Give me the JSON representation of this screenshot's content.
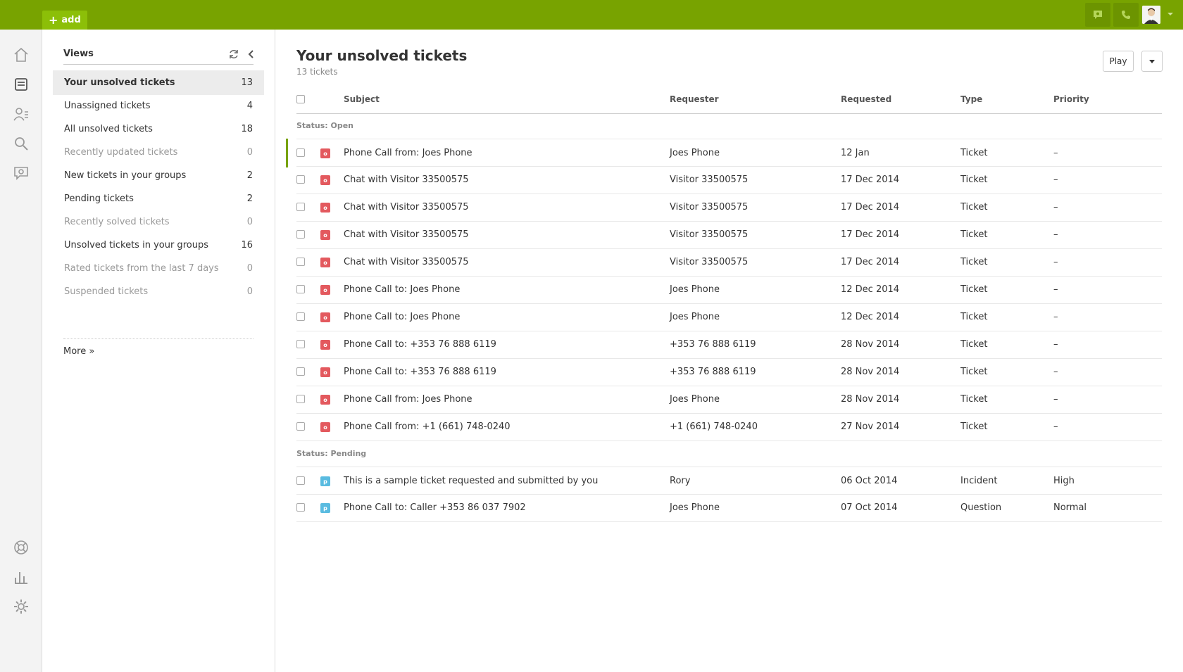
{
  "topbar": {
    "add_label": "add",
    "add_icon": "plus-icon",
    "accent": "#78a300",
    "icons": [
      "chat-icon",
      "phone-icon",
      "avatar"
    ]
  },
  "leftnav": {
    "items": [
      "home-icon",
      "views-icon",
      "customers-icon",
      "search-icon",
      "chat-icon",
      "help-icon",
      "reports-icon",
      "settings-icon"
    ]
  },
  "views": {
    "title": "Views",
    "items": [
      {
        "label": "Your unsolved tickets",
        "count": "13",
        "active": true,
        "dim": false
      },
      {
        "label": "Unassigned tickets",
        "count": "4",
        "active": false,
        "dim": false
      },
      {
        "label": "All unsolved tickets",
        "count": "18",
        "active": false,
        "dim": false
      },
      {
        "label": "Recently updated tickets",
        "count": "0",
        "active": false,
        "dim": true
      },
      {
        "label": "New tickets in your groups",
        "count": "2",
        "active": false,
        "dim": false
      },
      {
        "label": "Pending tickets",
        "count": "2",
        "active": false,
        "dim": false
      },
      {
        "label": "Recently solved tickets",
        "count": "0",
        "active": false,
        "dim": true
      },
      {
        "label": "Unsolved tickets in your groups",
        "count": "16",
        "active": false,
        "dim": false
      },
      {
        "label": "Rated tickets from the last 7 days",
        "count": "0",
        "active": false,
        "dim": true
      },
      {
        "label": "Suspended tickets",
        "count": "0",
        "active": false,
        "dim": true
      }
    ],
    "more_label": "More »"
  },
  "main": {
    "title": "Your unsolved tickets",
    "subtitle": "13 tickets",
    "play_label": "Play",
    "columns": {
      "subject": "Subject",
      "requester": "Requester",
      "requested": "Requested",
      "type": "Type",
      "priority": "Priority"
    },
    "groups": [
      {
        "label": "Status: Open",
        "status_letter": "o",
        "status_color": "#e3595e",
        "rows": [
          {
            "subject": "Phone Call from: Joes Phone",
            "requester": "Joes Phone",
            "requested": "12 Jan",
            "type": "Ticket",
            "priority": "–"
          },
          {
            "subject": "Chat with Visitor 33500575",
            "requester": "Visitor 33500575",
            "requested": "17 Dec 2014",
            "type": "Ticket",
            "priority": "–"
          },
          {
            "subject": "Chat with Visitor 33500575",
            "requester": "Visitor 33500575",
            "requested": "17 Dec 2014",
            "type": "Ticket",
            "priority": "–"
          },
          {
            "subject": "Chat with Visitor 33500575",
            "requester": "Visitor 33500575",
            "requested": "17 Dec 2014",
            "type": "Ticket",
            "priority": "–"
          },
          {
            "subject": "Chat with Visitor 33500575",
            "requester": "Visitor 33500575",
            "requested": "17 Dec 2014",
            "type": "Ticket",
            "priority": "–"
          },
          {
            "subject": "Phone Call to: Joes Phone",
            "requester": "Joes Phone",
            "requested": "12 Dec 2014",
            "type": "Ticket",
            "priority": "–"
          },
          {
            "subject": "Phone Call to: Joes Phone",
            "requester": "Joes Phone",
            "requested": "12 Dec 2014",
            "type": "Ticket",
            "priority": "–"
          },
          {
            "subject": "Phone Call to: +353 76 888 6119",
            "requester": "+353 76 888 6119",
            "requested": "28 Nov 2014",
            "type": "Ticket",
            "priority": "–"
          },
          {
            "subject": "Phone Call to: +353 76 888 6119",
            "requester": "+353 76 888 6119",
            "requested": "28 Nov 2014",
            "type": "Ticket",
            "priority": "–"
          },
          {
            "subject": "Phone Call from: Joes Phone",
            "requester": "Joes Phone",
            "requested": "28 Nov 2014",
            "type": "Ticket",
            "priority": "–"
          },
          {
            "subject": "Phone Call from: +1 (661) 748-0240",
            "requester": "+1 (661) 748-0240",
            "requested": "27 Nov 2014",
            "type": "Ticket",
            "priority": "–"
          }
        ]
      },
      {
        "label": "Status: Pending",
        "status_letter": "p",
        "status_color": "#59bbe0",
        "rows": [
          {
            "subject": "This is a sample ticket requested and submitted by you",
            "requester": "Rory",
            "requested": "06 Oct 2014",
            "type": "Incident",
            "priority": "High"
          },
          {
            "subject": "Phone Call to: Caller +353 86 037 7902",
            "requester": "Joes Phone",
            "requested": "07 Oct 2014",
            "type": "Question",
            "priority": "Normal"
          }
        ]
      }
    ]
  }
}
